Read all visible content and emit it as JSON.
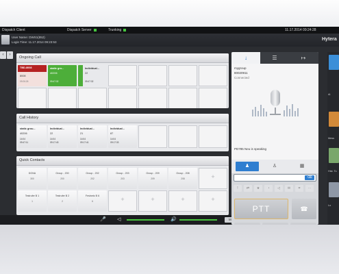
{
  "topbar": {
    "app_title": "Dispatch Client",
    "dispatch_server": "Dispatch Server",
    "trunking": "Trunking",
    "datetime": "11.17.2014 09:24:28"
  },
  "user": {
    "name_line": "User Name: DWS1(852)",
    "login_line": "Login Time: 11.17.2014 09:23:53"
  },
  "brand": "Hytera",
  "ongoing_call": {
    "title": "Ongoing Call",
    "cards": [
      {
        "l1": "TBD-8008",
        "l2": "8008",
        "l3": "09:26:26"
      },
      {
        "l1": "static gro...",
        "l2": "40206",
        "l3": "09:47:32"
      },
      {
        "l1": "Individual...",
        "l2": "22",
        "l3": "09:47:32"
      }
    ]
  },
  "call_history": {
    "title": "Call History",
    "cards": [
      {
        "l1": "static grou...",
        "l2": "40206",
        "l3": "14:04",
        "l4": "09:47:11"
      },
      {
        "l1": "Individual...",
        "l2": "22",
        "l3": "14:04",
        "l4": "09:17:43"
      },
      {
        "l1": "Individual...",
        "l2": "21",
        "l3": "14:04",
        "l4": "09:17:41"
      },
      {
        "l1": "Individual...",
        "l2": "87",
        "l3": "14:04",
        "l4": "09:17:33"
      }
    ]
  },
  "quick_contacts": {
    "title": "Quick Contacts",
    "items": [
      {
        "name": "DGNA",
        "num": "300"
      },
      {
        "name": "Group - 200",
        "num": "200"
      },
      {
        "name": "Group - 202",
        "num": "202"
      },
      {
        "name": "Group - 203",
        "num": "203"
      },
      {
        "name": "Group - 209",
        "num": "209"
      },
      {
        "name": "Group - 208",
        "num": "208"
      },
      {
        "name": "Testrufer B 1",
        "num": "1"
      },
      {
        "name": "Testrufer B 2",
        "num": "2"
      },
      {
        "name": "Festnetz B 6",
        "num": "6"
      }
    ],
    "plus": "+"
  },
  "call_panel": {
    "group_name": "mygroup",
    "group_number": "80020911",
    "status": "Connected",
    "speaking": "PD785 Neu is speaking",
    "ptt_label": "PTT",
    "mute_label": "Mute"
  },
  "right_strip": {
    "labels": [
      "Al",
      "Mess",
      "Hist. To",
      "Lo"
    ]
  },
  "icons": {
    "download": "↓",
    "list": "☰",
    "exit": "↦",
    "contacts": "♟",
    "person": "♙",
    "book": "▦",
    "clear": "⌫",
    "hangup": "☎",
    "pause": "❚❚",
    "chevron_down": "⌄",
    "forward": "»",
    "mic": "🎤",
    "speaker": "🔊",
    "speaker_small": "◁",
    "sidebar_toggle": "›",
    "nav_back": "‹"
  },
  "colors": {
    "accent_blue": "#2f7ed0",
    "alert_red": "#d9302f",
    "active_green": "#4dae3a"
  }
}
